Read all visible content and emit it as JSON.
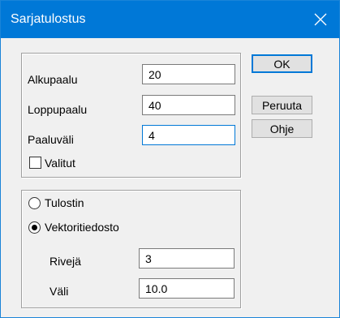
{
  "window": {
    "title": "Sarjatulostus",
    "titlebar_color": "#0078d7"
  },
  "range_group": {
    "start_label": "Alkupaalu",
    "start_value": "20",
    "end_label": "Loppupaalu",
    "end_value": "40",
    "interval_label": "Paaluväli",
    "interval_value": "4",
    "selected_label": "Valitut",
    "selected_checked": false
  },
  "output_group": {
    "printer_label": "Tulostin",
    "printer_selected": false,
    "vector_label": "Vektoritiedosto",
    "vector_selected": true,
    "rows_label": "Rivejä",
    "rows_value": "3",
    "spacing_label": "Väli",
    "spacing_value": "10.0"
  },
  "buttons": {
    "ok": "OK",
    "cancel": "Peruuta",
    "help": "Ohje"
  }
}
